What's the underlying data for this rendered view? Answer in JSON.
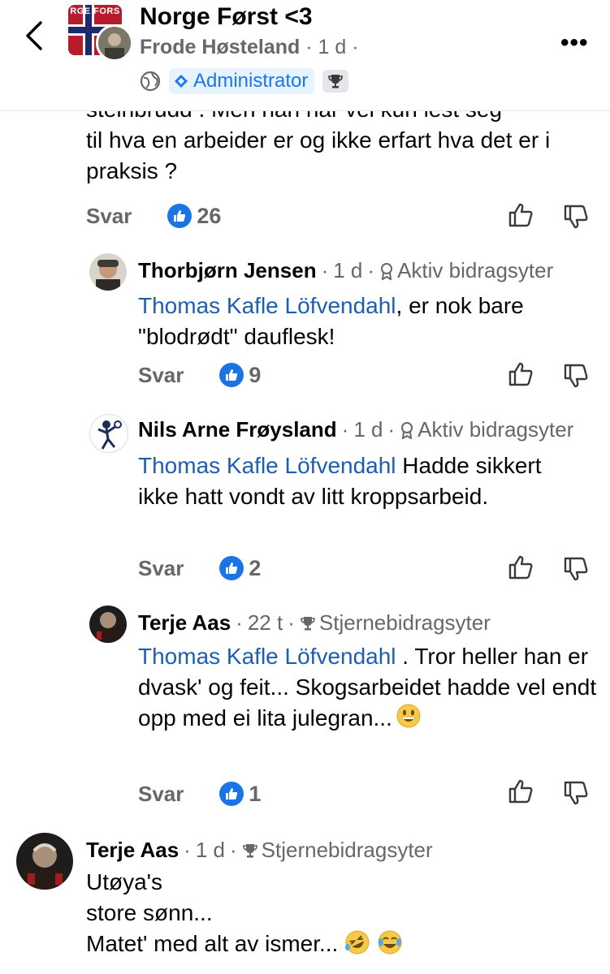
{
  "header": {
    "title": "Norge Først <3",
    "avatar_text": "RGE FORS",
    "author": "Frode Høsteland",
    "time": "1 d",
    "admin_badge": "Administrator"
  },
  "parent_comment": {
    "clipped_line": "steinbrudd . Men han har vel kun lest seg",
    "text": "til hva en arbeider er og ikke erfart hva det er i praksis ?",
    "reply_label": "Svar",
    "likes": "26"
  },
  "replies": [
    {
      "author": "Thorbjørn Jensen",
      "time": "1 d",
      "role": "Aktiv bidragsyter",
      "mention": "Thomas Kafle Löfvendahl",
      "text": ", er nok bare \"blodrødt\" dauflesk!",
      "reply_label": "Svar",
      "likes": "9"
    },
    {
      "author": "Nils Arne Frøysland",
      "time": "1 d",
      "role": "Aktiv bidragsyter",
      "mention": "Thomas Kafle Löfvendahl",
      "text": " Hadde sikkert ikke hatt vondt av litt kroppsarbeid.",
      "reply_label": "Svar",
      "likes": "2"
    },
    {
      "author": "Terje Aas",
      "time": "22 t",
      "role": "Stjernebidragsyter",
      "mention": "Thomas Kafle Löfvendahl",
      "text": " . Tror heller han er dvask' og feit...  Skogsarbeidet hadde vel endt opp med ei lita julegran...",
      "reply_label": "Svar",
      "likes": "1"
    }
  ],
  "bottom_comment": {
    "author": "Terje Aas",
    "time": "1 d",
    "role": "Stjernebidragsyter",
    "line1": "Utøya's",
    "line2": "store sønn...",
    "line3": "Matet' med alt av ismer..."
  },
  "colors": {
    "accent": "#1877f2",
    "like_blue": "#1b74e4",
    "mention": "#1c5fb0",
    "muted": "#65676b"
  }
}
